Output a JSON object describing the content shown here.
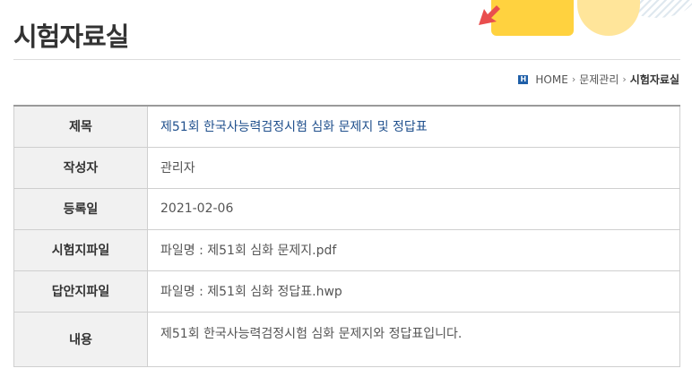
{
  "header": {
    "title": "시험자료실"
  },
  "breadcrumb": {
    "home_label": "HOME",
    "items": [
      "문제관리"
    ],
    "current": "시험자료실"
  },
  "detail": {
    "rows": [
      {
        "label": "제목",
        "value": "제51회 한국사능력검정시험 심화 문제지 및 정답표"
      },
      {
        "label": "작성자",
        "value": "관리자"
      },
      {
        "label": "등록일",
        "value": "2021-02-06"
      },
      {
        "label": "시험지파일",
        "value": "파일명 : 제51회 심화 문제지.pdf"
      },
      {
        "label": "답안지파일",
        "value": "파일명 : 제51회 심화 정답표.hwp"
      },
      {
        "label": "내용",
        "value": "제51회 한국사능력검정시험 심화 문제지와 정답표입니다."
      }
    ]
  },
  "colors": {
    "accent_blue": "#1f5fa8",
    "subject_text": "#1f4f8c",
    "header_bg": "#f1f1f1",
    "deco_yellow": "#ffd23f",
    "deco_arrow": "#e94e4e"
  },
  "icons": {
    "home": "home-icon",
    "arrow": "arrow-icon"
  }
}
